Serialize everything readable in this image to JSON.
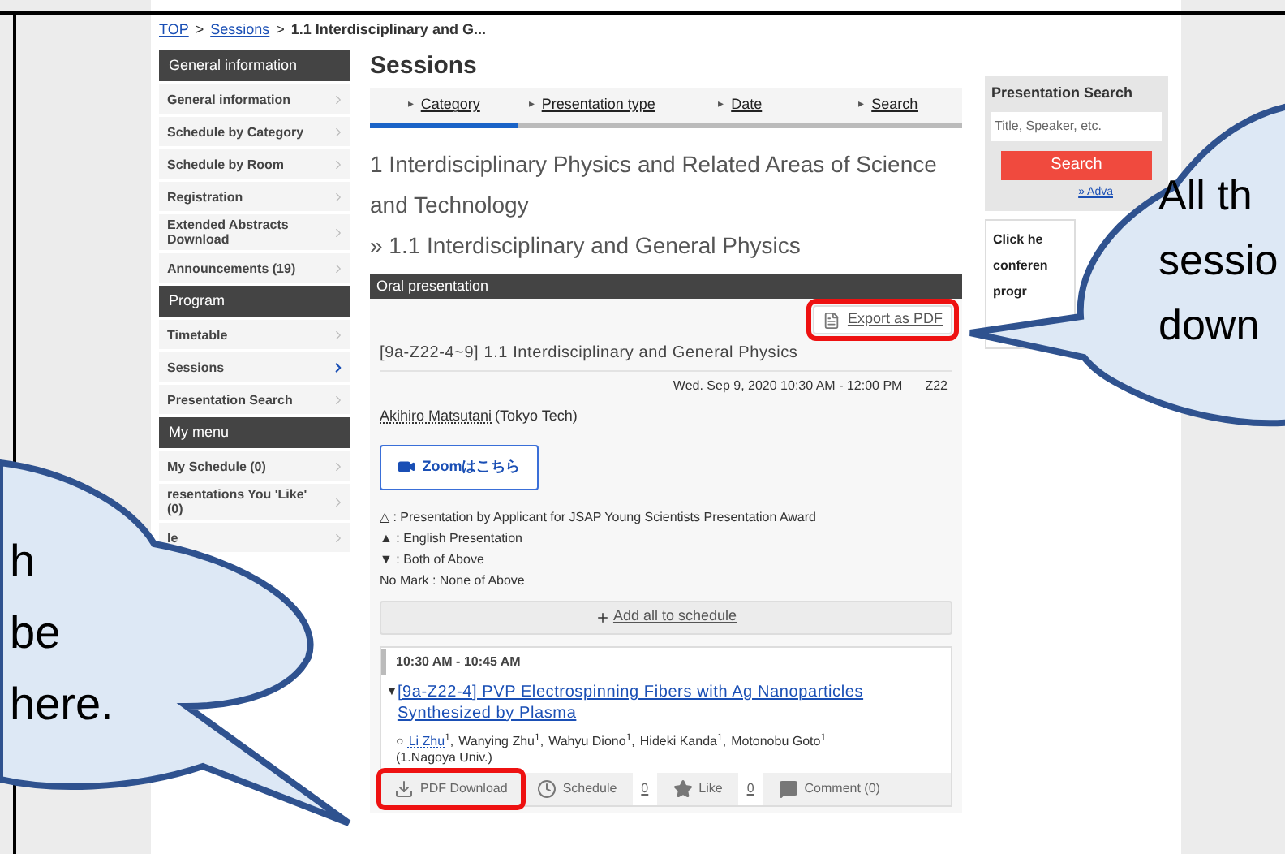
{
  "breadcrumb": [
    {
      "text": "TOP",
      "link": true
    },
    {
      "text": "Sessions",
      "link": true
    },
    {
      "text": "1.1 Interdisciplinary and G...",
      "link": false
    }
  ],
  "breadcrumb_separator": ">",
  "sidebar": [
    {
      "title": "General information",
      "items": [
        {
          "label": "General information",
          "selected": false
        },
        {
          "label": "Schedule by Category",
          "selected": false
        },
        {
          "label": "Schedule by Room",
          "selected": false
        },
        {
          "label": "Registration",
          "selected": false
        },
        {
          "label": "Extended Abstracts Download",
          "selected": false
        },
        {
          "label": "Announcements (19)",
          "selected": false
        }
      ]
    },
    {
      "title": "Program",
      "items": [
        {
          "label": "Timetable",
          "selected": false
        },
        {
          "label": "Sessions",
          "selected": true
        },
        {
          "label": "Presentation Search",
          "selected": false
        }
      ]
    },
    {
      "title": "My menu",
      "items": [
        {
          "label": "My Schedule (0)",
          "selected": false
        },
        {
          "label": "resentations You 'Like' (0)",
          "selected": false
        },
        {
          "label": "le",
          "selected": false
        }
      ]
    }
  ],
  "page_title": "Sessions",
  "tab_marker": "▸",
  "tabs": [
    {
      "label": "Category",
      "selected": true
    },
    {
      "label": "Presentation type",
      "selected": false
    },
    {
      "label": "Date",
      "selected": false
    },
    {
      "label": "Search",
      "selected": false
    }
  ],
  "category": "1 Interdisciplinary Physics and Related Areas of Science and Technology",
  "subcategory": "» 1.1 Interdisciplinary and General Physics",
  "panel": {
    "title": "Oral presentation",
    "export": "Export as PDF",
    "session": "[9a-Z22-4~9] 1.1 Interdisciplinary and General Physics",
    "datetime": "Wed. Sep 9, 2020 10:30 AM - 12:00 PM",
    "room": "Z22",
    "chair": "Akihiro Matsutani",
    "chair_affiliation": "(Tokyo Tech)",
    "zoom_button": "Zoomはこちら",
    "legend": [
      "△ : Presentation by Applicant for JSAP Young Scientists Presentation Award",
      "▲ : English Presentation",
      "▼ : Both of Above",
      "No Mark : None of Above"
    ],
    "add_all": "Add all to schedule"
  },
  "presentation": {
    "time": "10:30 AM - 10:45 AM",
    "marker": "▼",
    "title": "[9a-Z22-4] PVP Electrospinning Fibers with Ag Nanoparticles Synthesized by Plasma",
    "presenter_mark": "○",
    "author_separator": ",",
    "authors": [
      {
        "name": "Li Zhu",
        "sup": "1",
        "presenter": true
      },
      {
        "name": "Wanying Zhu",
        "sup": "1",
        "presenter": false
      },
      {
        "name": "Wahyu Diono",
        "sup": "1",
        "presenter": false
      },
      {
        "name": "Hideki Kanda",
        "sup": "1",
        "presenter": false
      },
      {
        "name": "Motonobu Goto",
        "sup": "1",
        "presenter": false
      }
    ],
    "affiliation": "(1.Nagoya Univ.)",
    "actions": [
      {
        "kind": "pdf",
        "label": "PDF Download"
      },
      {
        "kind": "schedule",
        "label": "Schedule",
        "count": "0"
      },
      {
        "kind": "like",
        "label": "Like",
        "count": "0"
      },
      {
        "kind": "comment",
        "label": "Comment (0)"
      }
    ]
  },
  "search_box": {
    "title": "Presentation Search",
    "placeholder": "Title, Speaker, etc.",
    "button": "Search",
    "advanced": "» Adva"
  },
  "notice_lines": [
    "Click he",
    "conferen",
    "progr"
  ],
  "callout_right": {
    "lines": [
      "All th",
      "sessio",
      "down"
    ]
  },
  "callout_left": {
    "lines": [
      "h",
      "be",
      "here."
    ]
  }
}
